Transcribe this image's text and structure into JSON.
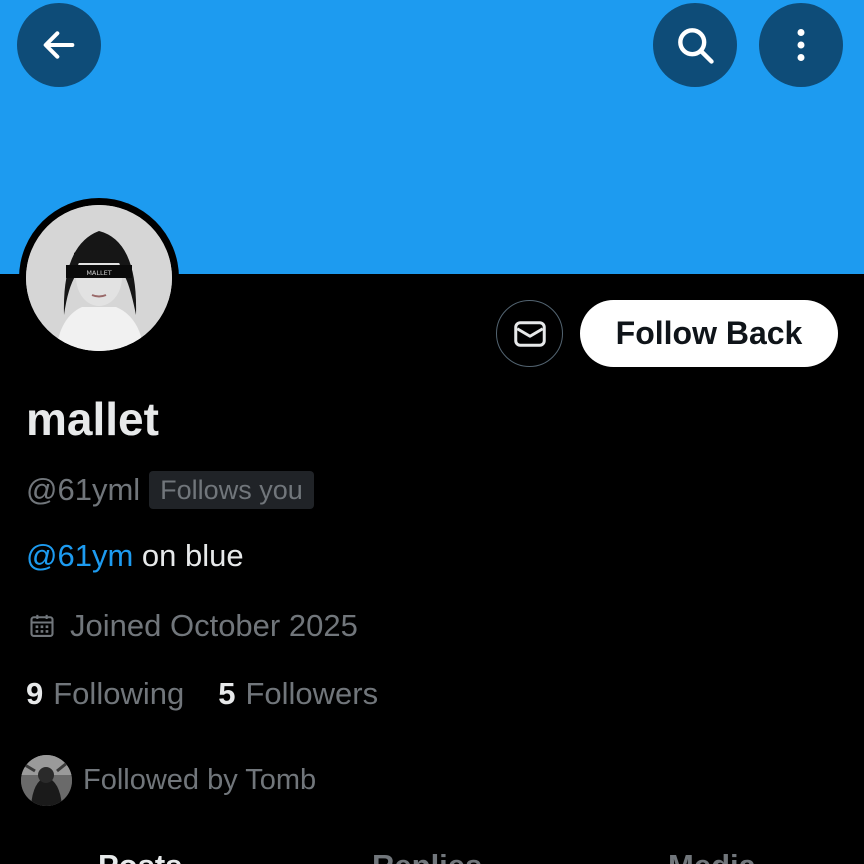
{
  "header": {
    "back_icon": "arrow-left-icon",
    "search_icon": "search-icon",
    "more_icon": "more-vertical-icon",
    "banner_color": "#1d9bf0"
  },
  "profile": {
    "avatar_text": "MALLET",
    "display_name": "mallet",
    "handle": "@61yml",
    "follows_you_badge": "Follows you",
    "bio_link": "@61ym",
    "bio_text": " on blue",
    "joined": "Joined October 2025",
    "following_count": "9",
    "following_label": "Following",
    "followers_count": "5",
    "followers_label": "Followers",
    "followed_by": "Followed by Tomb"
  },
  "actions": {
    "message_icon": "envelope-icon",
    "follow_back_label": "Follow Back"
  },
  "tabs": [
    {
      "label": "Posts",
      "active": true
    },
    {
      "label": "Replies",
      "active": false
    },
    {
      "label": "Media",
      "active": false
    }
  ],
  "colors": {
    "accent": "#1d9bf0",
    "text_primary": "#e7e9ea",
    "text_secondary": "#71767b",
    "background": "#000000"
  }
}
